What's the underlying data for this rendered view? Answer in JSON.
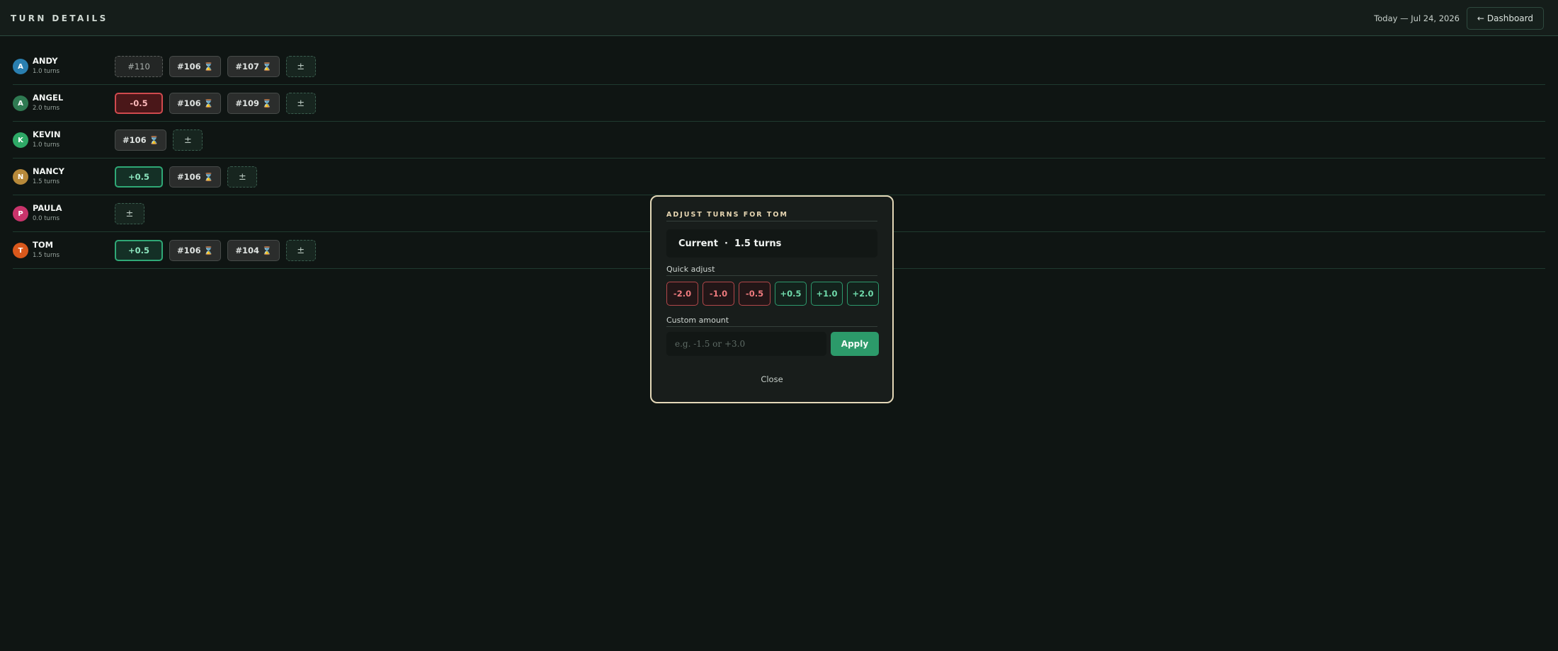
{
  "header": {
    "title": "TURN  DETAILS",
    "date": "Today — Jul 24, 2026",
    "dashboard_label": "Dashboard",
    "dashboard_arrow": "←"
  },
  "icons": {
    "hourglass": "⌛",
    "adjust": "±"
  },
  "players": [
    {
      "initial": "A",
      "name": "ANDY",
      "turns": "1.0 turns",
      "avatar_color": "#2a7fb0",
      "chips": [
        {
          "kind": "dashed",
          "label": "#110"
        },
        {
          "kind": "pending",
          "label": "#106"
        },
        {
          "kind": "pending",
          "label": "#107"
        }
      ]
    },
    {
      "initial": "A",
      "name": "ANGEL",
      "turns": "2.0 turns",
      "avatar_color": "#2f7a52",
      "chips": [
        {
          "kind": "neg",
          "label": "-0.5"
        },
        {
          "kind": "pending",
          "label": "#106"
        },
        {
          "kind": "pending",
          "label": "#109"
        }
      ]
    },
    {
      "initial": "K",
      "name": "KEVIN",
      "turns": "1.0 turns",
      "avatar_color": "#2ea866",
      "chips": [
        {
          "kind": "pending",
          "label": "#106"
        }
      ]
    },
    {
      "initial": "N",
      "name": "NANCY",
      "turns": "1.5 turns",
      "avatar_color": "#b7893a",
      "chips": [
        {
          "kind": "pos",
          "label": "+0.5"
        },
        {
          "kind": "pending",
          "label": "#106"
        }
      ]
    },
    {
      "initial": "P",
      "name": "PAULA",
      "turns": "0.0 turns",
      "avatar_color": "#c9346b",
      "chips": []
    },
    {
      "initial": "T",
      "name": "TOM",
      "turns": "1.5 turns",
      "avatar_color": "#d9581c",
      "chips": [
        {
          "kind": "pos",
          "label": "+0.5"
        },
        {
          "kind": "pending",
          "label": "#106"
        },
        {
          "kind": "pending",
          "label": "#104"
        }
      ]
    }
  ],
  "modal": {
    "title": "ADJUST TURNS FOR TOM",
    "current_text": "Current  ·  1.5 turns",
    "quick_label": "Quick adjust",
    "quick_options": [
      "-2.0",
      "-1.0",
      "-0.5",
      "+0.5",
      "+1.0",
      "+2.0"
    ],
    "custom_label": "Custom amount",
    "custom_placeholder": "e.g. -1.5 or +3.0",
    "custom_value": "",
    "apply_label": "Apply",
    "close_label": "Close"
  },
  "colors": {
    "accent_green": "#2c9a6a",
    "negative_red": "#d04a4e",
    "modal_border": "#e4d8b8"
  }
}
